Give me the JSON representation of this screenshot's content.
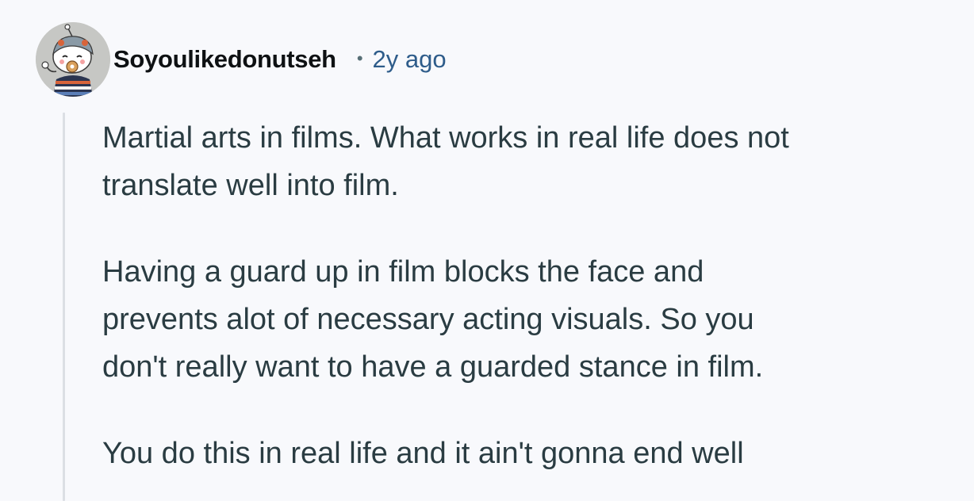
{
  "comment": {
    "author": "Soyoulikedonutseh",
    "separator": "•",
    "timestamp": "2y ago",
    "avatar_icon": "snoo-avatar-icon",
    "paragraphs": [
      "Martial arts in films. What works in real life does not\ntranslate well into film.",
      "Having a guard up in film blocks the face and\nprevents alot of necessary acting visuals. So you\ndon't really want to have a guarded stance in film.",
      "You do this in real life and it ain't gonna end well"
    ]
  },
  "colors": {
    "background": "#f8f9fc",
    "author": "#0e1113",
    "timestamp": "#2e5c8a",
    "body_text": "#2a3c42",
    "thread_line": "#dcdfe4"
  }
}
